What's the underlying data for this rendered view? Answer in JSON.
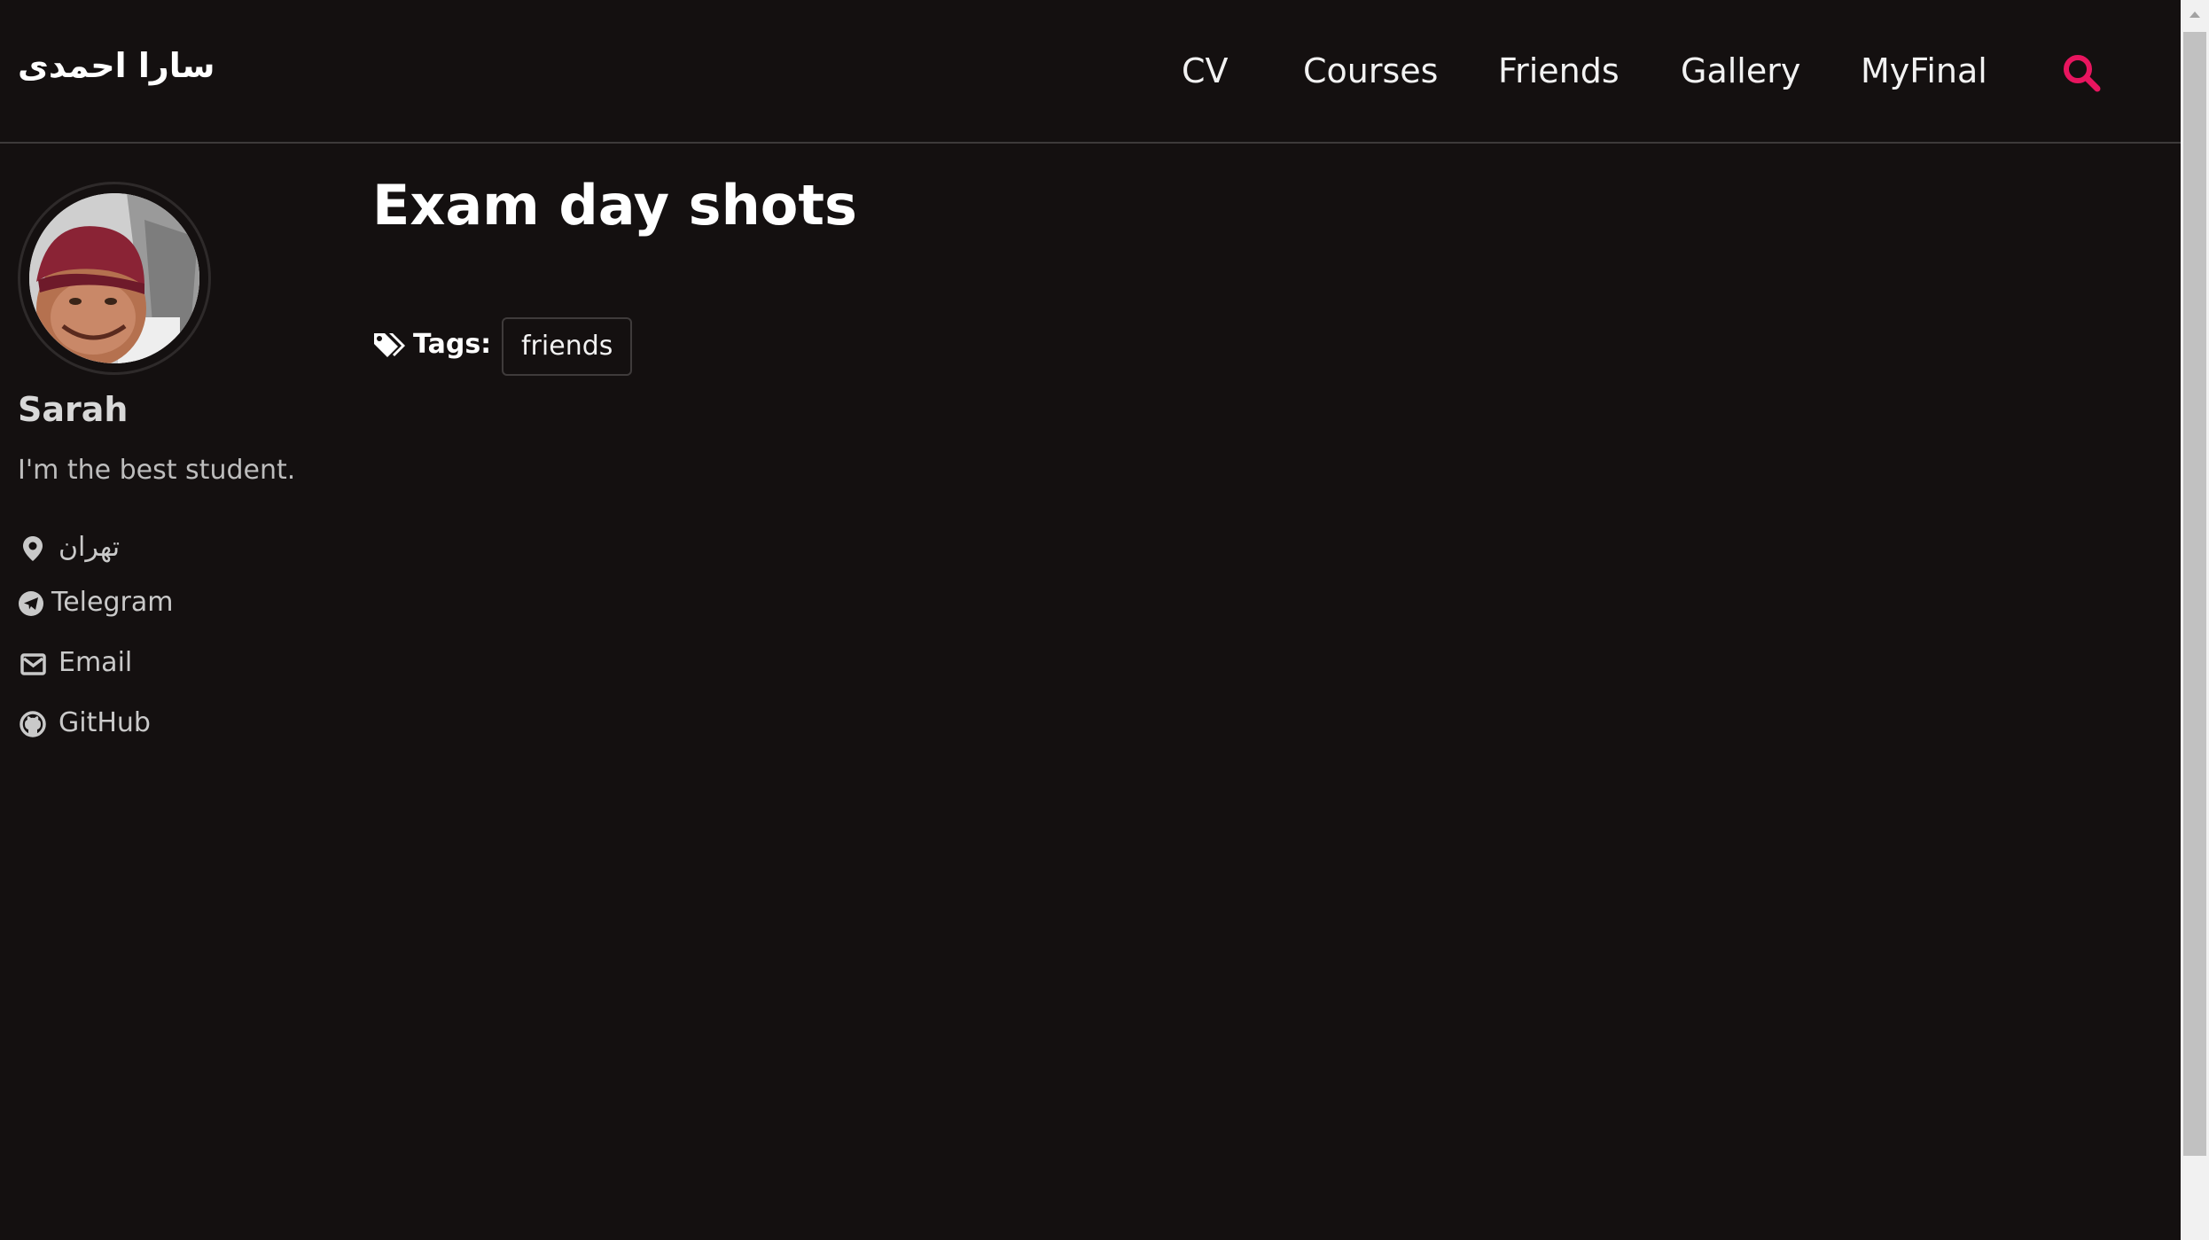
{
  "masthead": {
    "site_title": "سارا احمدی",
    "nav": [
      {
        "label": "CV"
      },
      {
        "label": "Courses"
      },
      {
        "label": "Friends"
      },
      {
        "label": "Gallery"
      },
      {
        "label": "MyFinal"
      }
    ],
    "search_icon": "search-icon",
    "accent_color": "#e8155f"
  },
  "author": {
    "name": "Sarah",
    "bio": "I'm the best student.",
    "location": "تهران",
    "links": [
      {
        "label": "Telegram",
        "icon": "telegram-icon"
      },
      {
        "label": "Email",
        "icon": "envelope-icon"
      },
      {
        "label": "GitHub",
        "icon": "github-icon"
      }
    ]
  },
  "page": {
    "title": "Exam day shots",
    "tags_label": "Tags:",
    "tags": [
      "friends"
    ]
  },
  "colors": {
    "background": "#141010",
    "text": "#ffffff",
    "muted_text": "#c9c9c9",
    "border": "#3d3a3a"
  }
}
